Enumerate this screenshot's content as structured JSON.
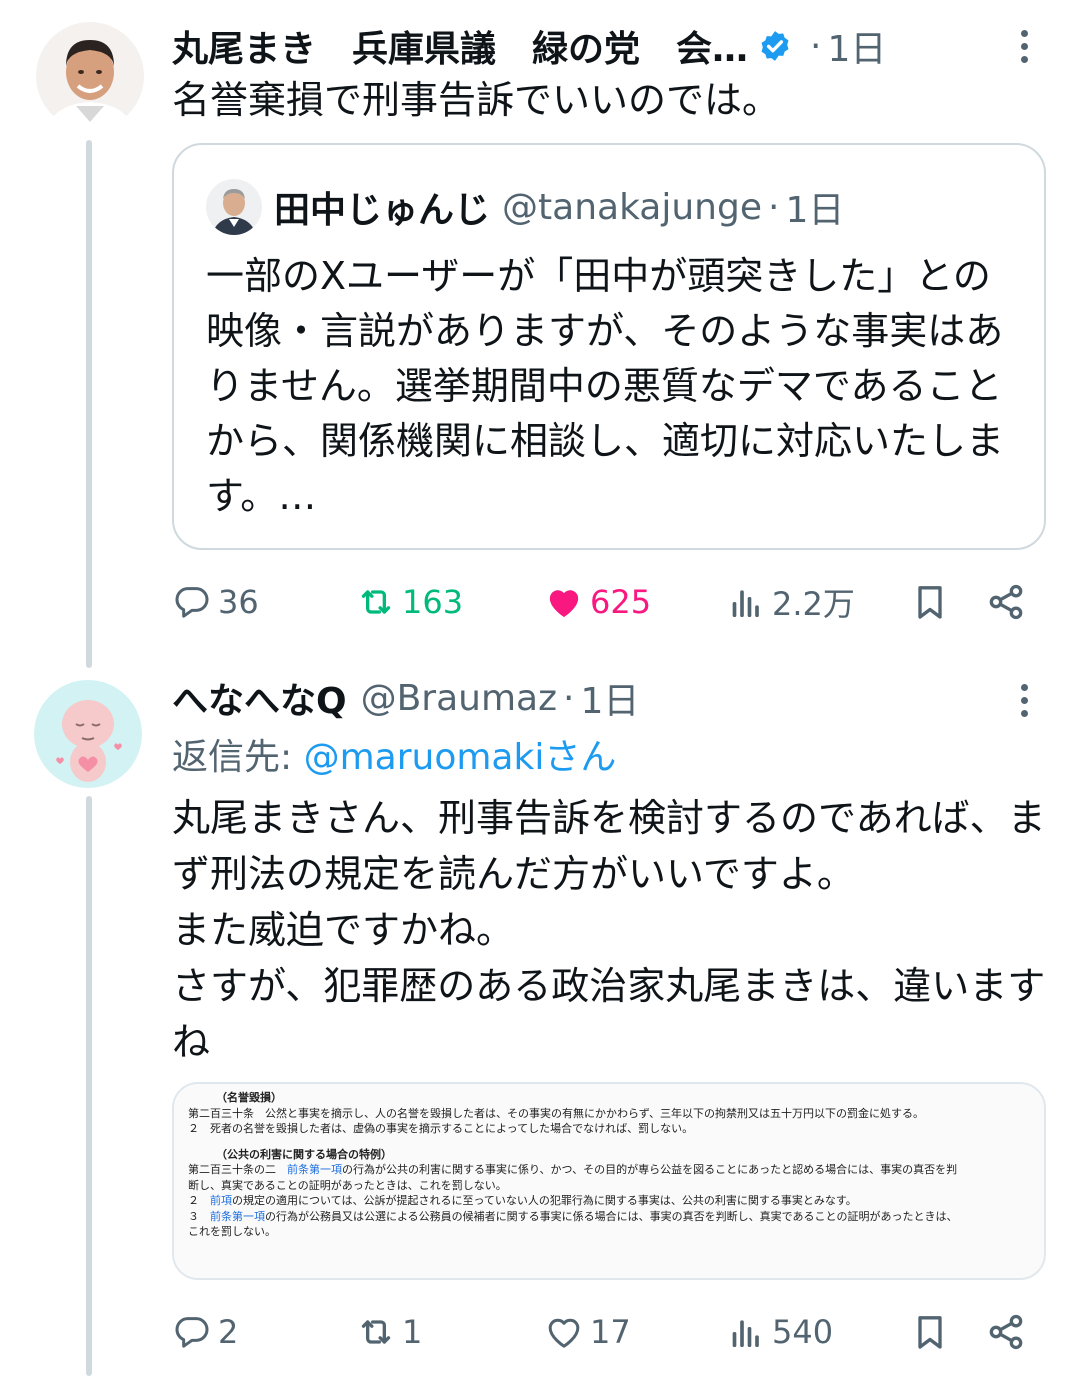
{
  "tweet1": {
    "display_name": "丸尾まき　兵庫県議　緑の党　会…",
    "verified": true,
    "dot": "·",
    "time": "1日",
    "text": "名誉棄損で刑事告訴でいいのでは。",
    "quote": {
      "display_name": "田中じゅんじ",
      "handle": "@tanakajunge",
      "dot": "·",
      "time": "1日",
      "text": "一部のXユーザーが「田中が頭突きした」との映像・言説がありますが、そのような事実はありません。選挙期間中の悪質なデマであることから、関係機関に相談し、適切に対応いたします。…"
    },
    "actions": {
      "replies": "36",
      "retweets": "163",
      "likes": "625",
      "views": "2.2万"
    }
  },
  "tweet2": {
    "display_name": "へなへなQ",
    "handle": "@Braumaz",
    "dot": "·",
    "time": "1日",
    "reply_prefix": "返信先: ",
    "reply_mention": "@maruomakiさん",
    "text": "丸尾まきさん、刑事告訴を検討するのであれば、まず刑法の規定を読んだ方がいいですよ。\nまた威迫ですかね。\nさすが、犯罪歴のある政治家丸尾まきは、違いますね",
    "image_doc": {
      "line1": "（名誉毀損）",
      "line2": "第二百三十条　公然と事実を摘示し、人の名誉を毀損した者は、その事実の有無にかかわらず、三年以下の拘禁刑又は五十万円以下の罰金に処する。",
      "line3": "２　死者の名誉を毀損した者は、虚偽の事実を摘示することによってした場合でなければ、罰しない。",
      "line4": "（公共の利害に関する場合の特例）",
      "line5a": "第二百三十条の二　",
      "line5link": "前条第一項",
      "line5b": "の行為が公共の利害に関する事実に係り、かつ、その目的が専ら公益を図ることにあったと認める場合には、事実の真否を判",
      "line6": "断し、真実であることの証明があったときは、これを罰しない。",
      "line7a": "２　",
      "line7link": "前項",
      "line7b": "の規定の適用については、公訴が提起されるに至っていない人の犯罪行為に関する事実は、公共の利害に関する事実とみなす。",
      "line8a": "３　",
      "line8link": "前条第一項",
      "line8b": "の行為が公務員又は公選による公務員の候補者に関する事実に係る場合には、事実の真否を判断し、真実であることの証明があったときは、",
      "line9": "これを罰しない。"
    },
    "actions": {
      "replies": "2",
      "retweets": "1",
      "likes": "17",
      "views": "540"
    }
  },
  "colors": {
    "accent": "#1d9bf0",
    "like_active": "#f91880",
    "retweet_active": "#00ba7c",
    "muted": "#536471"
  }
}
